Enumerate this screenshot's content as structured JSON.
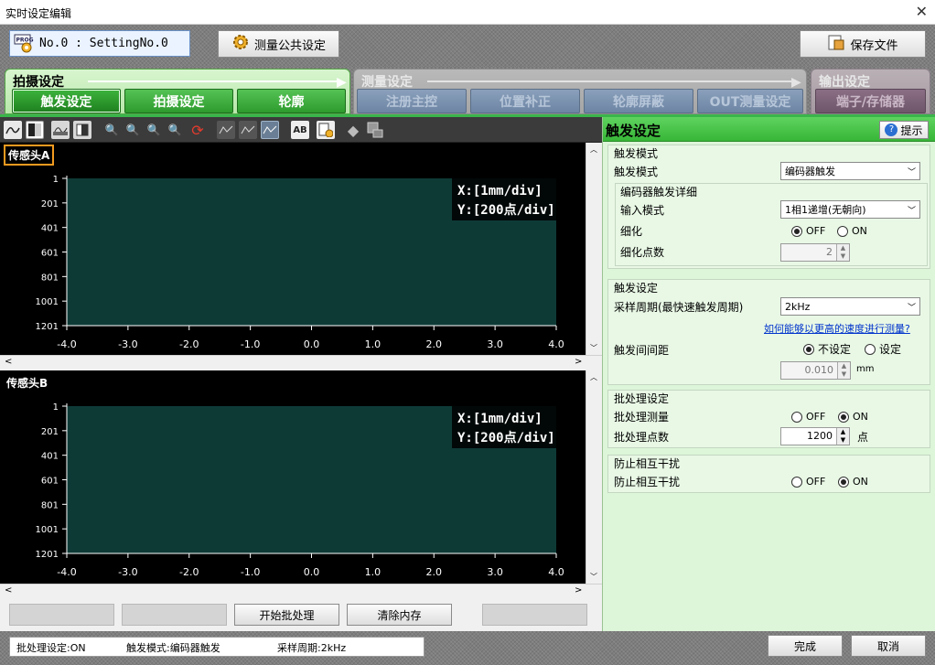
{
  "window": {
    "title": "实时设定编辑"
  },
  "header": {
    "program_label": "No.0 : SettingNo.0",
    "common_settings_label": "测量公共设定",
    "save_file_label": "保存文件"
  },
  "tabs": {
    "groups": [
      {
        "title": "拍摄设定",
        "state": "active",
        "items": [
          "触发设定",
          "拍摄设定",
          "轮廓"
        ]
      },
      {
        "title": "测量设定",
        "state": "disabled",
        "items": [
          "注册主控",
          "位置补正",
          "轮廓屏蔽",
          "OUT测量设定"
        ]
      },
      {
        "title": "输出设定",
        "state": "disabled",
        "items": [
          "端子/存储器"
        ]
      }
    ]
  },
  "charts": {
    "sensor_a_label": "传感头A",
    "sensor_b_label": "传感头B",
    "x_info": "X:[1mm/div]",
    "y_info": "Y:[200点/div]",
    "y_ticks": [
      "1",
      "201",
      "401",
      "601",
      "801",
      "1001",
      "1201"
    ],
    "x_ticks": [
      "-4.0",
      "-3.0",
      "-2.0",
      "-1.0",
      "0.0",
      "1.0",
      "2.0",
      "3.0",
      "4.0"
    ]
  },
  "bottom_buttons": {
    "start_batch": "开始批处理",
    "clear_memory": "清除内存"
  },
  "status": {
    "batch": "批处理设定:ON",
    "trigger_mode": "触发模式:编码器触发",
    "sample": "采样周期:2kHz"
  },
  "footer": {
    "finish": "完成",
    "cancel": "取消"
  },
  "panel": {
    "title": "触发设定",
    "hint": "提示",
    "trigger_mode_section": "触发模式",
    "trigger_mode_label": "触发模式",
    "trigger_mode_value": "编码器触发",
    "encoder_detail_title": "编码器触发详细",
    "input_mode_label": "输入模式",
    "input_mode_value": "1相1递增(无朝向)",
    "refine_label": "细化",
    "refine_off": "OFF",
    "refine_on": "ON",
    "refine_points_label": "细化点数",
    "refine_points_value": "2",
    "trigger_section": "触发设定",
    "sample_period_label": "采样周期(最快速触发周期)",
    "sample_period_value": "2kHz",
    "faster_link": "如何能够以更高的速度进行测量?",
    "interval_label": "触发间间距",
    "interval_none": "不设定",
    "interval_set": "设定",
    "interval_value": "0.010",
    "interval_unit": "mm",
    "batch_section": "批处理设定",
    "batch_measure_label": "批处理测量",
    "batch_off": "OFF",
    "batch_on": "ON",
    "batch_points_label": "批处理点数",
    "batch_points_value": "1200",
    "batch_points_unit": "点",
    "interference_section": "防止相互干扰",
    "interference_label": "防止相互干扰",
    "interference_off": "OFF",
    "interference_on": "ON"
  }
}
